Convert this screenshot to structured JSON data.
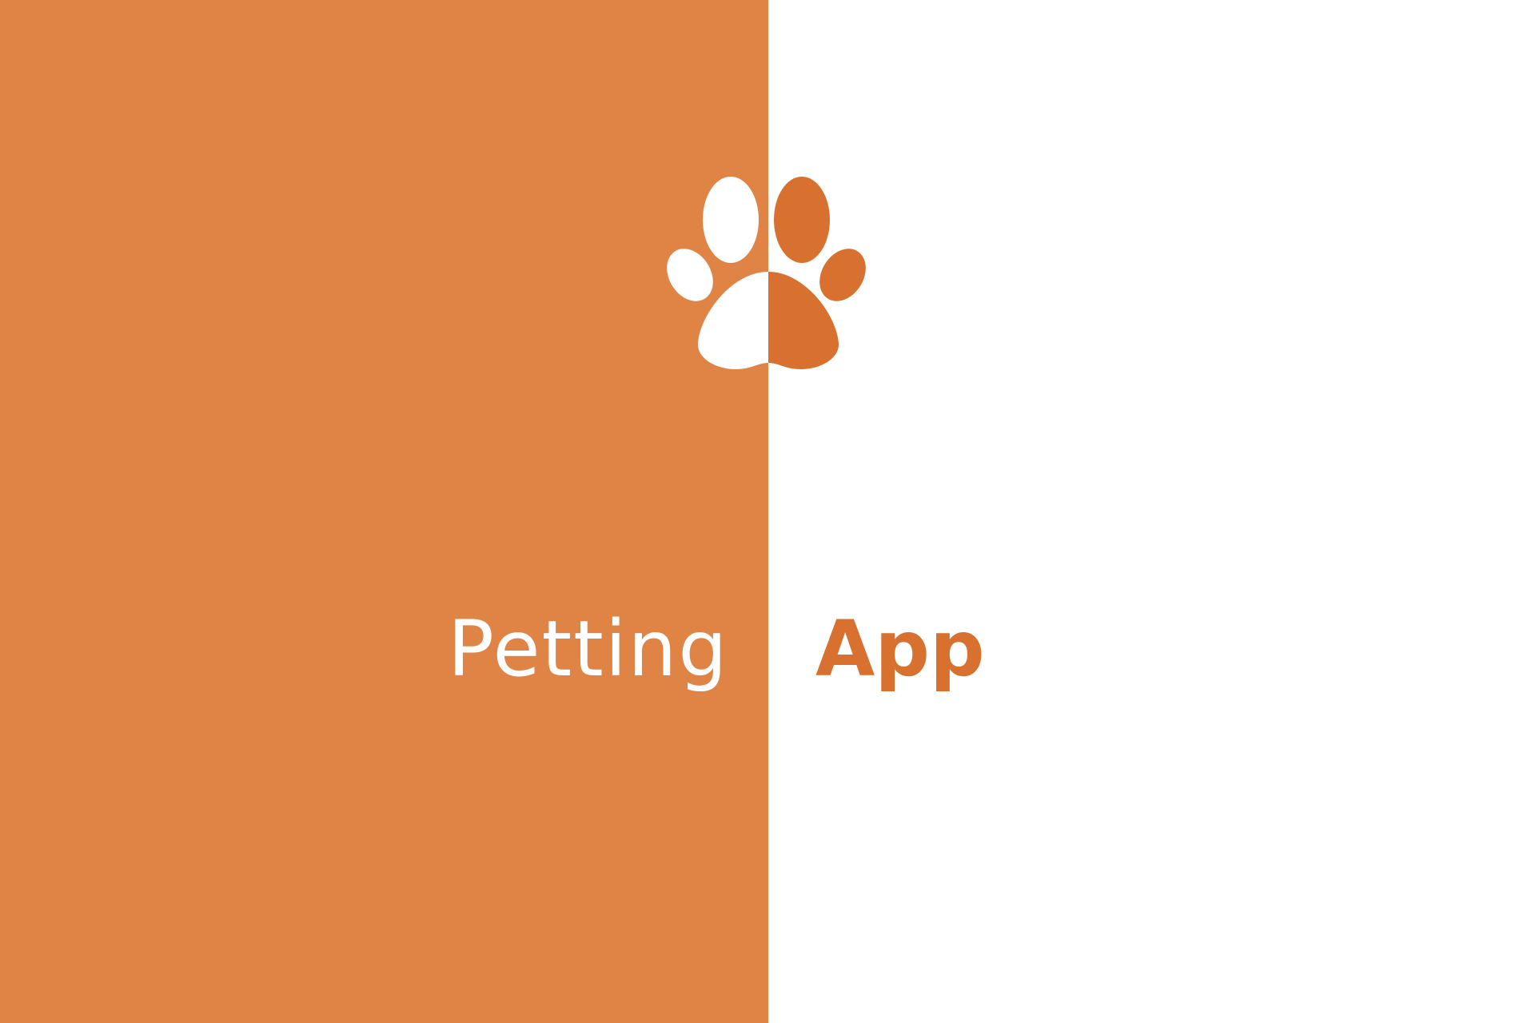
{
  "splash": {
    "word_left": "Petting",
    "word_right": "App",
    "logo_icon": "paw-print-icon"
  },
  "colors": {
    "left_background": "#E08446",
    "right_background": "#FFFFFF",
    "paw_left_half": "#FFFFFF",
    "paw_right_half": "#D8702F",
    "word_left_color": "#FFFFFF",
    "word_right_color": "#D8702F"
  }
}
